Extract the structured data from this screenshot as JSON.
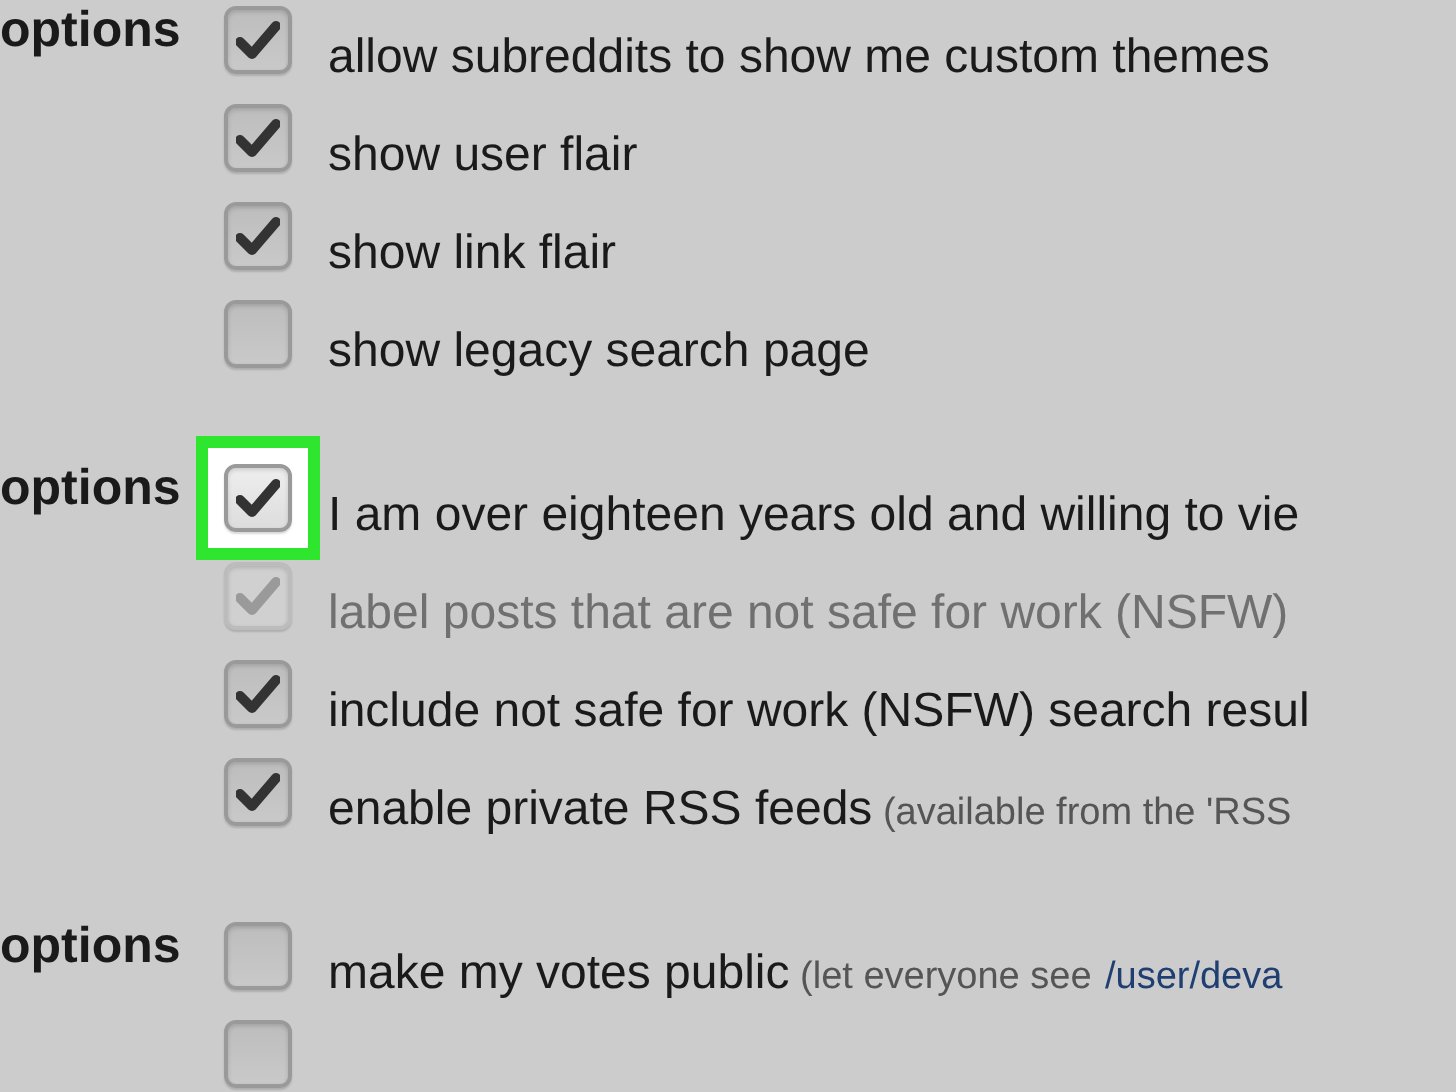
{
  "sections": [
    {
      "title": "options",
      "options": [
        {
          "label": "allow subreddits to show me custom themes",
          "checked": true,
          "disabled": false,
          "highlighted": false
        },
        {
          "label": "show user flair",
          "checked": true,
          "disabled": false,
          "highlighted": false
        },
        {
          "label": "show link flair",
          "checked": true,
          "disabled": false,
          "highlighted": false
        },
        {
          "label": "show legacy search page",
          "checked": false,
          "disabled": false,
          "highlighted": false
        }
      ]
    },
    {
      "title": "options",
      "options": [
        {
          "label": "I am over eighteen years old and willing to vie",
          "checked": true,
          "disabled": false,
          "highlighted": true
        },
        {
          "label": "label posts that are not safe for work (NSFW)",
          "checked": true,
          "disabled": true,
          "highlighted": false
        },
        {
          "label": "include not safe for work (NSFW) search resul",
          "checked": true,
          "disabled": false,
          "highlighted": false
        },
        {
          "label": "enable private RSS feeds",
          "note": "(available from the 'RSS",
          "checked": true,
          "disabled": false,
          "highlighted": false
        }
      ]
    },
    {
      "title": "options",
      "options": [
        {
          "label": "make my votes public",
          "note": "(let everyone see",
          "link": "/user/deva",
          "checked": false,
          "disabled": false,
          "highlighted": false
        },
        {
          "checked": false,
          "disabled": false,
          "highlighted": false
        }
      ]
    }
  ]
}
